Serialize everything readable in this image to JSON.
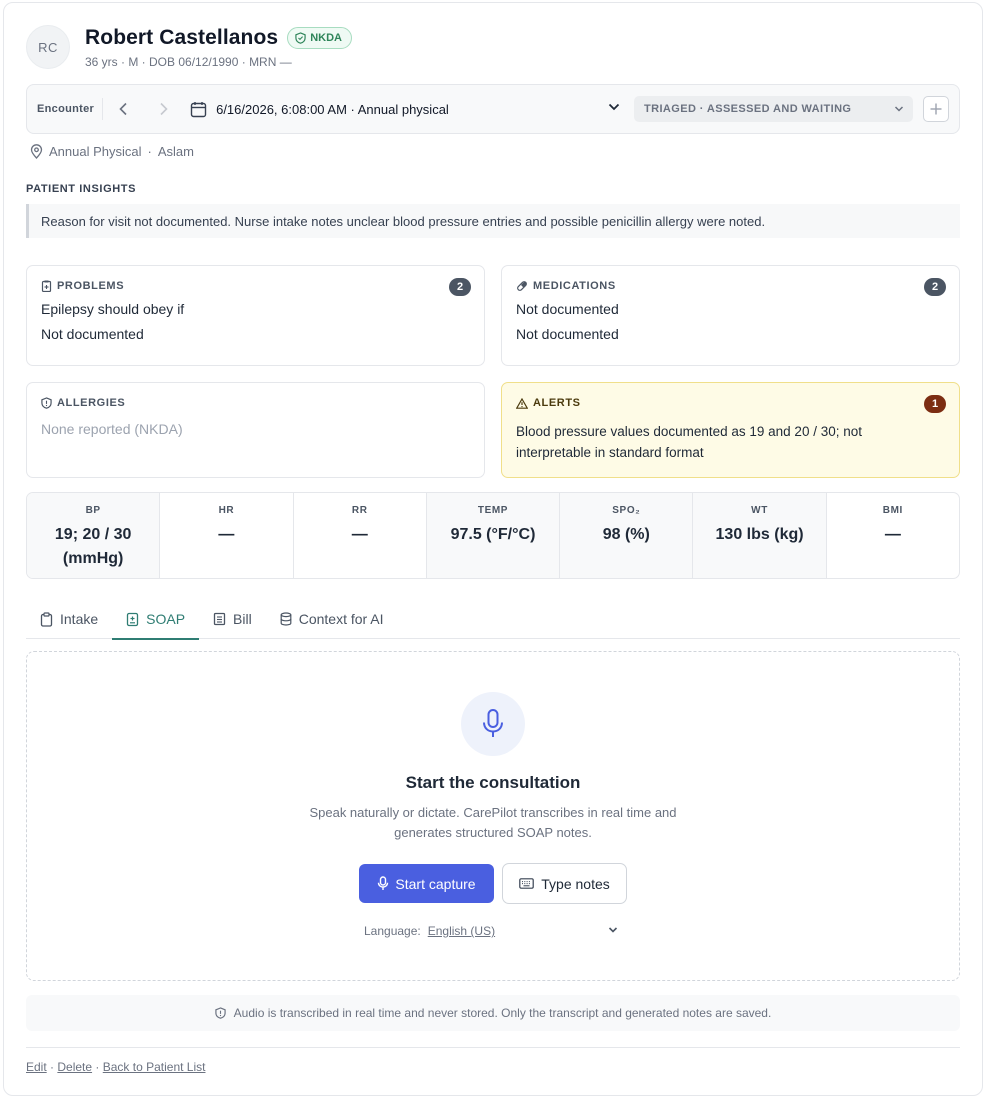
{
  "patient": {
    "initials": "RC",
    "name": "Robert Castellanos",
    "badge": "NKDA",
    "demographics": "36 yrs · M · DOB 06/12/1990 · MRN —"
  },
  "encounter": {
    "label": "Encounter",
    "selected": "6/16/2026, 6:08:00 AM · Annual physical",
    "status": "TRIAGED · ASSESSED AND WAITING",
    "location": "Annual Physical",
    "separator": "·",
    "provider": "Aslam"
  },
  "insights": {
    "title": "PATIENT INSIGHTS",
    "text": "Reason for visit not documented. Nurse intake notes unclear blood pressure entries and possible penicillin allergy were noted."
  },
  "problems": {
    "title": "PROBLEMS",
    "count": "2",
    "items": [
      "Epilepsy should obey if",
      "Not documented"
    ]
  },
  "medications": {
    "title": "MEDICATIONS",
    "count": "2",
    "items": [
      "Not documented",
      "Not documented"
    ]
  },
  "allergies": {
    "title": "ALLERGIES",
    "empty_text": "None reported (NKDA)"
  },
  "alerts": {
    "title": "ALERTS",
    "count": "1",
    "text": "Blood pressure values documented as 19 and 20 / 30; not interpretable in standard format"
  },
  "vitals": [
    {
      "label": "BP",
      "value_line1": "19; 20 / 30",
      "value_line2": "(mmHg)"
    },
    {
      "label": "HR",
      "value_line1": "—",
      "value_line2": ""
    },
    {
      "label": "RR",
      "value_line1": "—",
      "value_line2": ""
    },
    {
      "label": "TEMP",
      "value_line1": "97.5 (°F/°C)",
      "value_line2": ""
    },
    {
      "label": "SPO₂",
      "value_line1": "98 (%)",
      "value_line2": ""
    },
    {
      "label": "WT",
      "value_line1": "130 lbs (kg)",
      "value_line2": ""
    },
    {
      "label": "BMI",
      "value_line1": "—",
      "value_line2": ""
    }
  ],
  "tabs": [
    {
      "label": "Intake",
      "icon": "clipboard-icon"
    },
    {
      "label": "SOAP",
      "icon": "soap-note-icon",
      "active": true
    },
    {
      "label": "Bill",
      "icon": "receipt-icon"
    },
    {
      "label": "Context for AI",
      "icon": "database-icon"
    }
  ],
  "capture": {
    "title": "Start the consultation",
    "desc_line1": "Speak naturally or dictate. CarePilot transcribes in real time and",
    "desc_line2": "generates structured SOAP notes.",
    "start_label": "Start capture",
    "type_label": "Type notes",
    "language_label": "Language:",
    "language_value": "English (US)"
  },
  "privacy_note": "Audio is transcribed in real time and never stored. Only the transcript and generated notes are saved.",
  "footer": {
    "edit": "Edit",
    "delete": "Delete",
    "back": "Back to Patient List",
    "sep": "·"
  },
  "colors": {
    "accent": "#4a5fe0",
    "tab_active": "#2f7d73",
    "alert_bg": "#fefbe6",
    "alert_badge": "#7c2d12",
    "nkda_green": "#2f855a"
  }
}
